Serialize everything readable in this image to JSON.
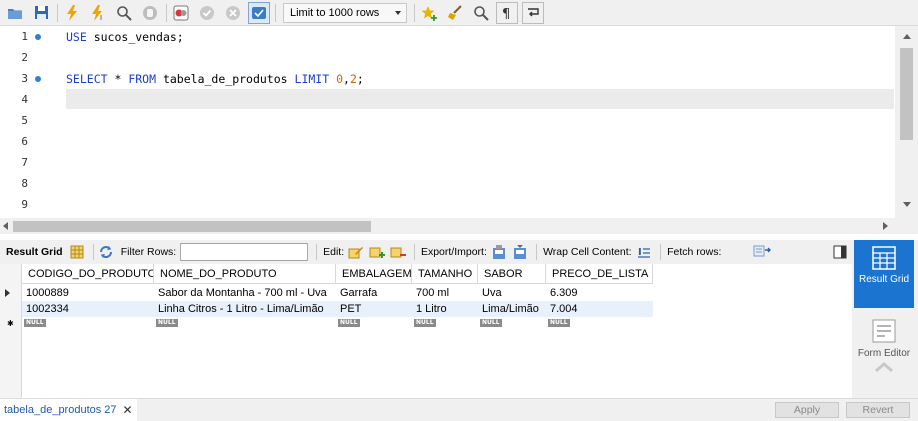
{
  "toolbar": {
    "limit_label": "Limit to 1000 rows"
  },
  "editor": {
    "line_numbers": [
      "1",
      "2",
      "3",
      "4",
      "5",
      "6",
      "7",
      "8",
      "9"
    ],
    "line1": {
      "kw": "USE",
      "rest": " sucos_vendas;"
    },
    "line3": {
      "kw1": "SELECT",
      "mid1": " * ",
      "kw2": "FROM",
      "mid2": " tabela_de_produtos ",
      "kw3": "LIMIT",
      "sp": " ",
      "n1": "0",
      "comma": ",",
      "n2": "2",
      "end": ";"
    }
  },
  "result_toolbar": {
    "result_grid": "Result Grid",
    "filter_rows": "Filter Rows:",
    "edit": "Edit:",
    "export_import": "Export/Import:",
    "wrap_cell": "Wrap Cell Content:",
    "fetch_rows": "Fetch rows:"
  },
  "grid": {
    "columns": [
      "CODIGO_DO_PRODUTO",
      "NOME_DO_PRODUTO",
      "EMBALAGEM",
      "TAMANHO",
      "SABOR",
      "PRECO_DE_LISTA"
    ],
    "rows": [
      [
        "1000889",
        "Sabor da Montanha - 700 ml - Uva",
        "Garrafa",
        "700 ml",
        "Uva",
        "6.309"
      ],
      [
        "1002334",
        "Linha Citros - 1 Litro - Lima/Limão",
        "PET",
        "1 Litro",
        "Lima/Limão",
        "7.004"
      ]
    ],
    "null_label": "NULL"
  },
  "side_panel": {
    "result_grid": "Result Grid",
    "form_editor": "Form Editor"
  },
  "bottom": {
    "tab_label": "tabela_de_produtos 27",
    "tab_close": "✕",
    "apply": "Apply",
    "revert": "Revert"
  }
}
